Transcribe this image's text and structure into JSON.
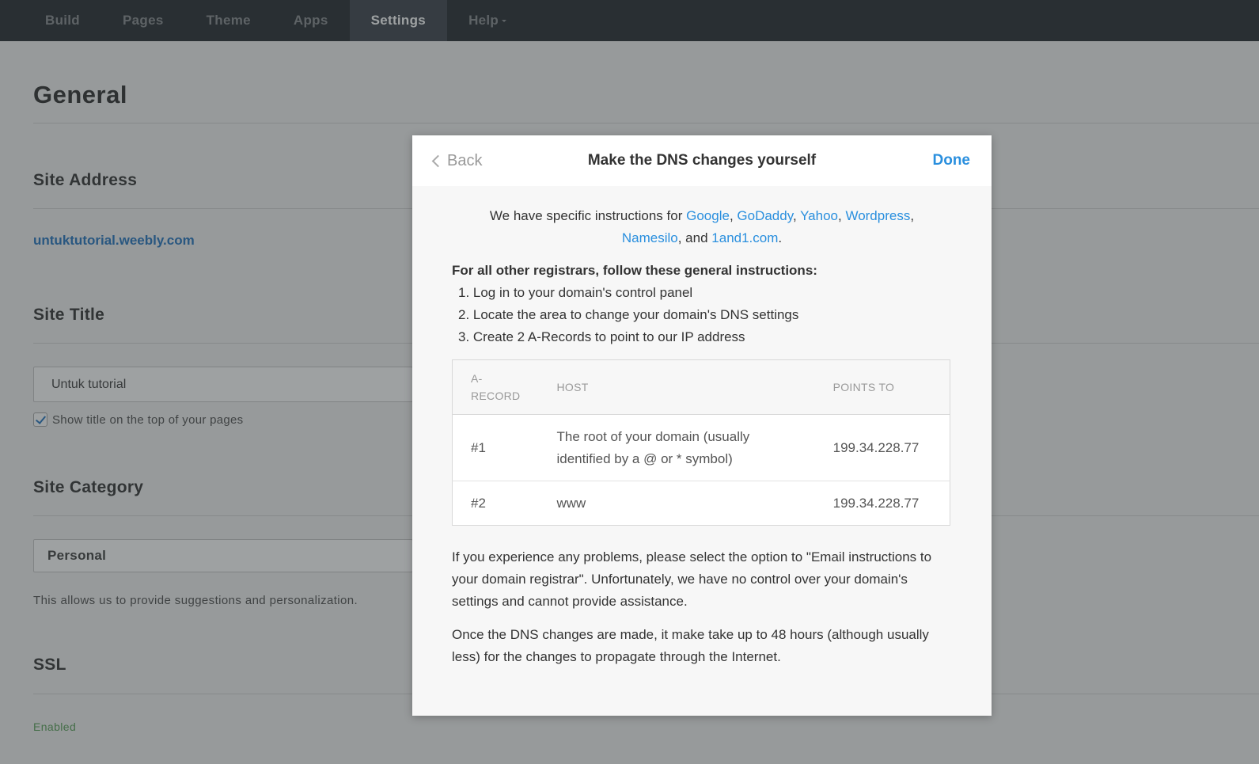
{
  "nav": {
    "items": [
      {
        "label": "Build"
      },
      {
        "label": "Pages"
      },
      {
        "label": "Theme"
      },
      {
        "label": "Apps"
      },
      {
        "label": "Settings"
      },
      {
        "label": "Help"
      }
    ],
    "active": "Settings"
  },
  "page": {
    "title": "General",
    "site_address": {
      "title": "Site Address",
      "value": "untuktutorial.weebly.com"
    },
    "site_title": {
      "title": "Site Title",
      "value": "Untuk tutorial",
      "checkbox_label": "Show title on the top of your pages"
    },
    "site_category": {
      "title": "Site Category",
      "value": "Personal",
      "help": "This allows us to provide suggestions and personalization."
    },
    "ssl": {
      "title": "SSL",
      "status": "Enabled"
    }
  },
  "modal": {
    "back_label": "Back",
    "title": "Make the DNS changes yourself",
    "done_label": "Done",
    "intro_prefix": "We have specific instructions for",
    "providers": [
      "Google",
      "GoDaddy",
      "Yahoo",
      "Wordpress",
      "Namesilo",
      "1and1.com"
    ],
    "intro_and": "and",
    "general_title": "For all other registrars, follow these general instructions:",
    "steps": [
      "1. Log in to your domain's control panel",
      "2. Locate the area to change your domain's DNS settings",
      "3. Create 2 A-Records to point to our IP address"
    ],
    "table": {
      "headers": {
        "record_line1": "A-",
        "record_line2": "RECORD",
        "host": "HOST",
        "points_to": "POINTS TO"
      },
      "rows": [
        {
          "record": "#1",
          "host": "The root of your domain (usually identified by a @ or * symbol)",
          "points_to": "199.34.228.77"
        },
        {
          "record": "#2",
          "host": "www",
          "points_to": "199.34.228.77"
        }
      ]
    },
    "problems_text": "If you experience any problems, please select the option to \"Email instructions to your domain registrar\". Unfortunately, we have no control over your domain's settings and cannot provide assistance.",
    "propagation_text": "Once the DNS changes are made, it make take up to 48 hours (although usually less) for the changes to propagate through the Internet."
  },
  "colors": {
    "nav_bg": "#2b3035",
    "link": "#2a8fde",
    "site_link": "#2a78c2",
    "enabled": "#5da35d"
  }
}
